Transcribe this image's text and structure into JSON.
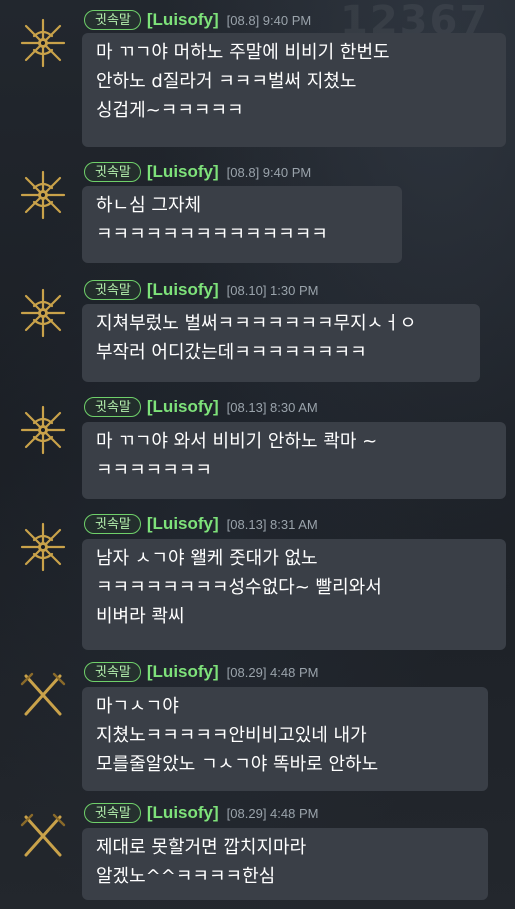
{
  "background_text": "12367",
  "messages": [
    {
      "badge": "귓속말",
      "name": "[Luisofy]",
      "time": "[08.8] 9:40 PM",
      "lines": [
        "마 ㄲㄱ야 머하노 주말에 비비기 한번도",
        "안하노 d질라거 ㅋㅋㅋ벌써 지쳤노",
        "싱겁게~ㅋㅋㅋㅋㅋ"
      ],
      "avatar": "star-emblem-icon"
    },
    {
      "badge": "귓속말",
      "name": "[Luisofy]",
      "time": "[08.8] 9:40 PM",
      "lines": [
        "하ㄴ심 그자체",
        "ㅋㅋㅋㅋㅋㅋㅋㅋㅋㅋㅋㅋㅋㅋ"
      ],
      "avatar": "star-emblem-icon"
    },
    {
      "badge": "귓속말",
      "name": "[Luisofy]",
      "time": "[08.10] 1:30 PM",
      "lines": [
        "지쳐부렀노 벌써ㅋㅋㅋㅋㅋㅋㅋ무지ㅅㅓㅇ",
        "부작러 어디갔는데ㅋㅋㅋㅋㅋㅋㅋㅋ"
      ],
      "avatar": "star-emblem-icon"
    },
    {
      "badge": "귓속말",
      "name": "[Luisofy]",
      "time": "[08.13] 8:30 AM",
      "lines": [
        "마 ㄲㄱ야 와서 비비기 안하노 콱마 ~",
        "ㅋㅋㅋㅋㅋㅋㅋ"
      ],
      "avatar": "star-emblem-icon"
    },
    {
      "badge": "귓속말",
      "name": "[Luisofy]",
      "time": "[08.13] 8:31 AM",
      "lines": [
        "남자 ㅅㄱ야 왤케 줏대가 없노",
        "ㅋㅋㅋㅋㅋㅋㅋㅋ성수없다~ 빨리와서",
        "비벼라 콱씨"
      ],
      "avatar": "star-emblem-icon"
    },
    {
      "badge": "귓속말",
      "name": "[Luisofy]",
      "time": "[08.29] 4:48 PM",
      "lines": [
        "마ㄱㅅㄱ야",
        "지쳤노ㅋㅋㅋㅋㅋ안비비고있네 내가",
        "모를줄알았노 ㄱㅅㄱ야 똑바로 안하노"
      ],
      "avatar": "crossed-swords-icon"
    },
    {
      "badge": "귓속말",
      "name": "[Luisofy]",
      "time": "[08.29] 4:48 PM",
      "lines": [
        "제대로 못할거면 깝치지마라",
        "알겠노^^ㅋㅋㅋㅋ한심"
      ],
      "avatar": "crossed-swords-icon"
    }
  ],
  "colors": {
    "badge_border": "#6fd06a",
    "name": "#7ee27a",
    "bubble": "#3a3f47",
    "avatar_gold": "#c9a24a"
  }
}
